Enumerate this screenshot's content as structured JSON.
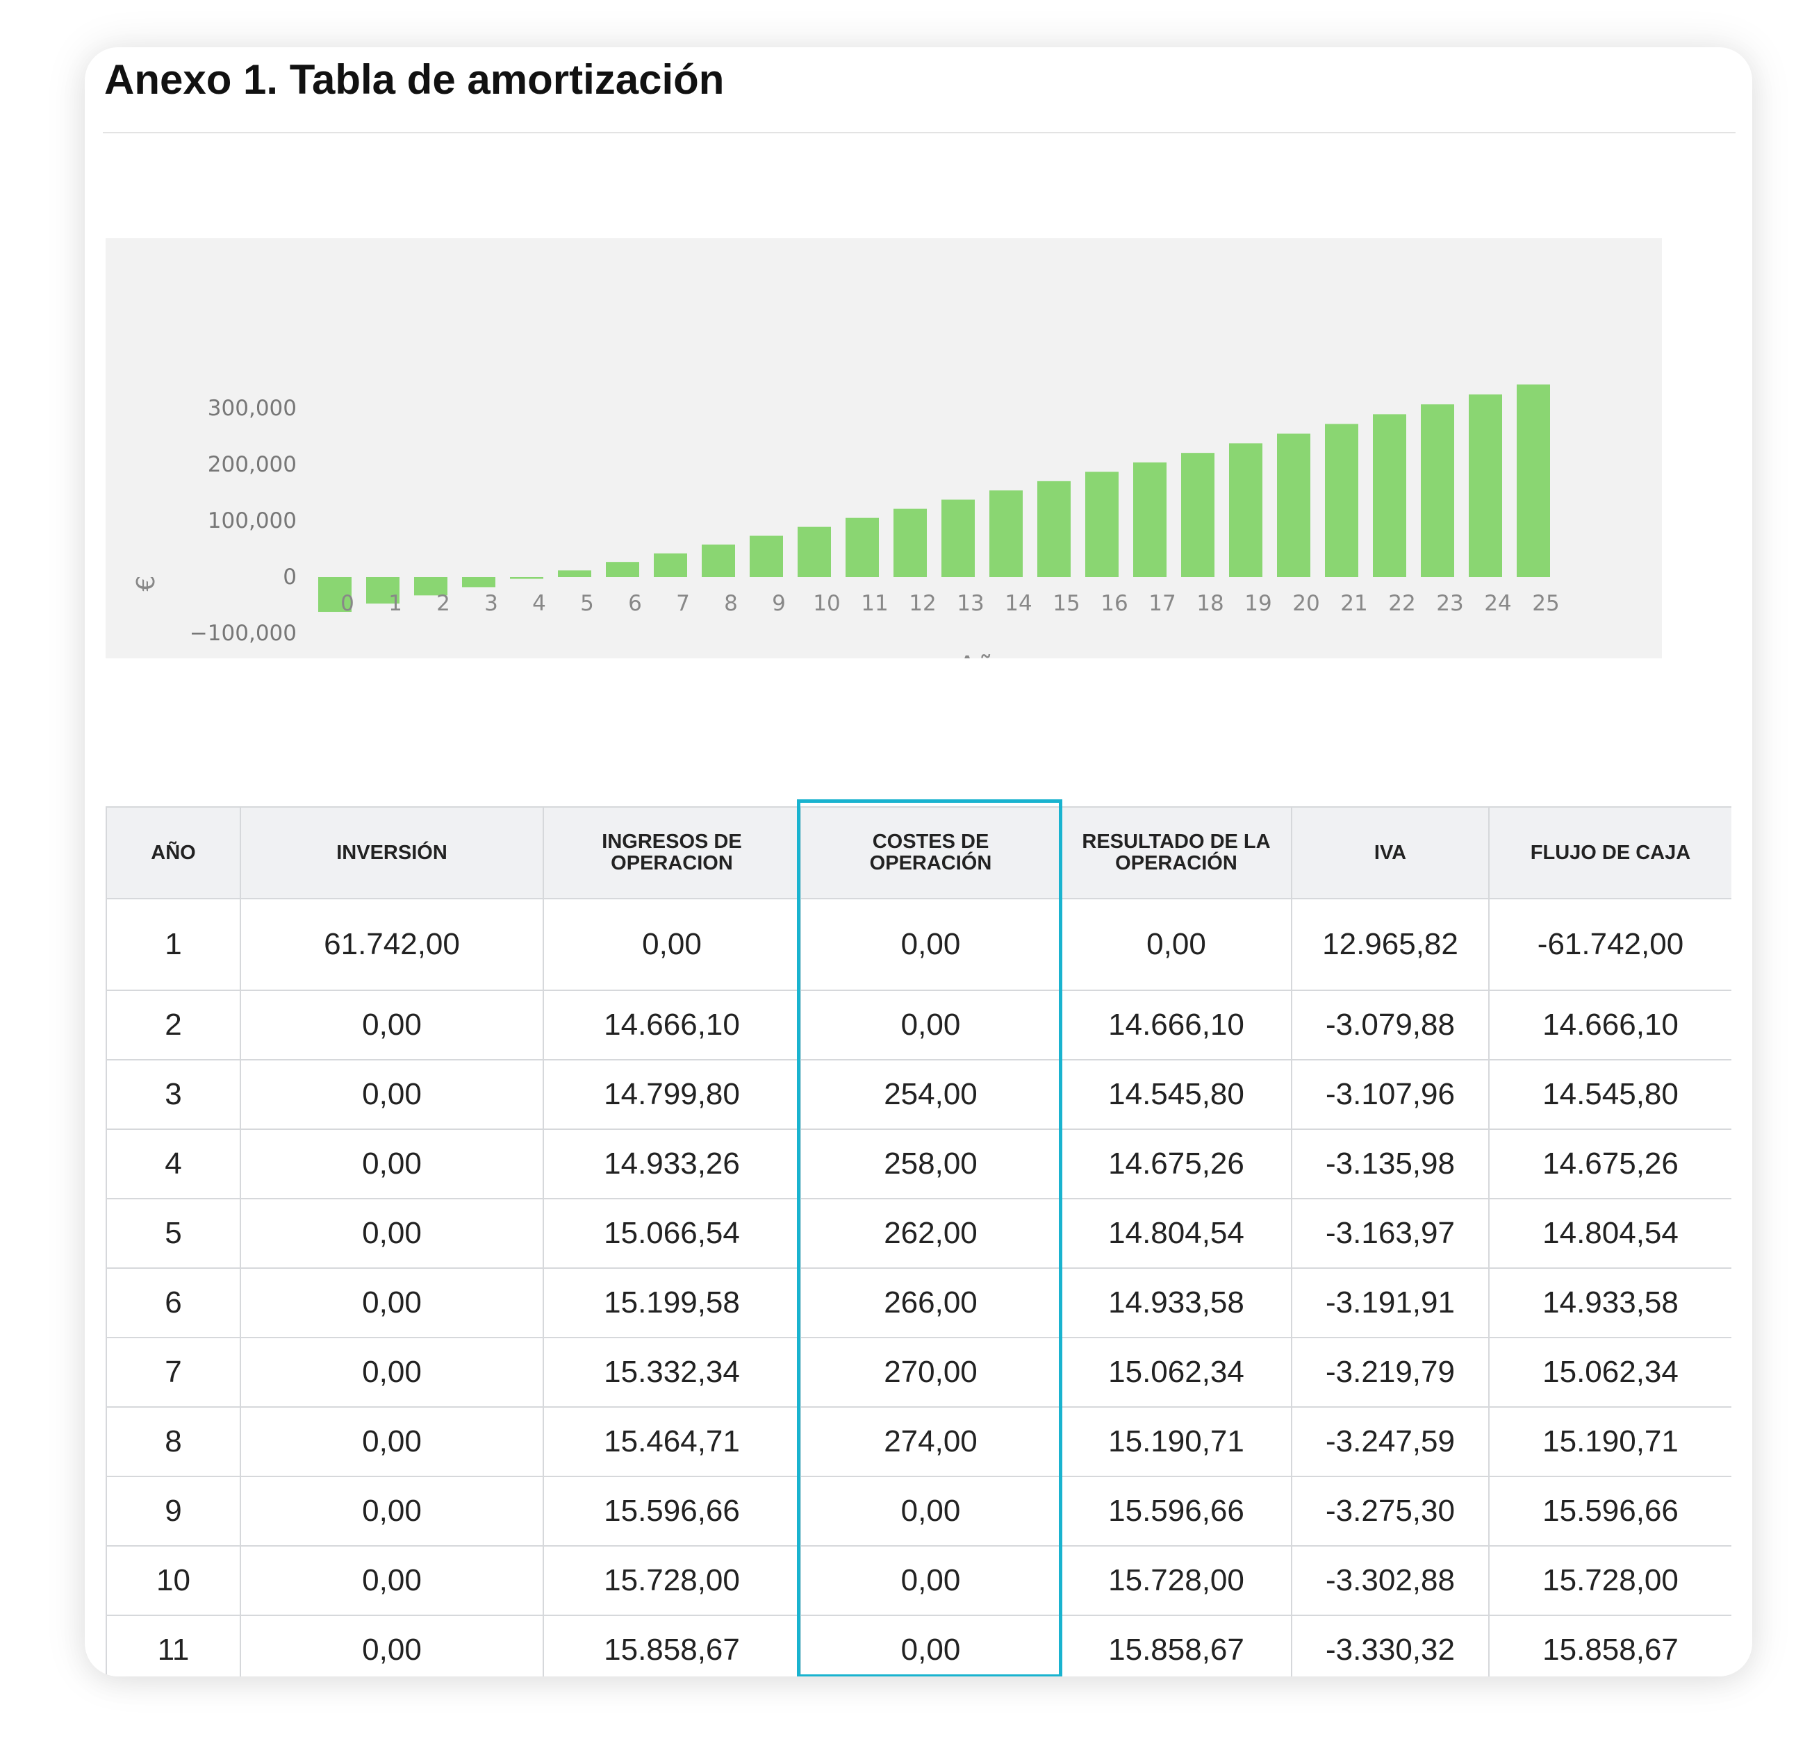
{
  "title": "Anexo 1. Tabla de amortización",
  "chart_data": {
    "type": "bar",
    "xlabel": "Año",
    "ylabel": "€",
    "ylim": [
      -100000,
      350000
    ],
    "yticks": [
      -100000,
      0,
      100000,
      200000,
      300000
    ],
    "ytick_labels": [
      "−100,000",
      "0",
      "100,000",
      "200,000",
      "300,000"
    ],
    "categories": [
      "0",
      "1",
      "2",
      "3",
      "4",
      "5",
      "6",
      "7",
      "8",
      "9",
      "10",
      "11",
      "12",
      "13",
      "14",
      "15",
      "16",
      "17",
      "18",
      "19",
      "20",
      "21",
      "22",
      "23",
      "24",
      "25"
    ],
    "values": [
      -61742,
      -47076,
      -32530,
      -17855,
      -3050,
      11883,
      26946,
      42136,
      57732,
      73460,
      89319,
      105308,
      121426,
      137672,
      154046,
      170548,
      187176,
      203931,
      220813,
      237820,
      254953,
      272212,
      289596,
      307104,
      324737,
      342494
    ],
    "bar_color": "#8ad672",
    "background": "#f2f2f2",
    "grid": false
  },
  "table": {
    "headers": [
      [
        "AÑO"
      ],
      [
        "INVERSIÓN"
      ],
      [
        "INGRESOS DE",
        "OPERACION"
      ],
      [
        "COSTES DE",
        "OPERACIÓN"
      ],
      [
        "RESULTADO DE LA",
        "OPERACIÓN"
      ],
      [
        "IVA"
      ],
      [
        "FLUJO DE CAJA"
      ]
    ],
    "rows": [
      [
        "1",
        "61.742,00",
        "0,00",
        "0,00",
        "0,00",
        "12.965,82",
        "-61.742,00"
      ],
      [
        "2",
        "0,00",
        "14.666,10",
        "0,00",
        "14.666,10",
        "-3.079,88",
        "14.666,10"
      ],
      [
        "3",
        "0,00",
        "14.799,80",
        "254,00",
        "14.545,80",
        "-3.107,96",
        "14.545,80"
      ],
      [
        "4",
        "0,00",
        "14.933,26",
        "258,00",
        "14.675,26",
        "-3.135,98",
        "14.675,26"
      ],
      [
        "5",
        "0,00",
        "15.066,54",
        "262,00",
        "14.804,54",
        "-3.163,97",
        "14.804,54"
      ],
      [
        "6",
        "0,00",
        "15.199,58",
        "266,00",
        "14.933,58",
        "-3.191,91",
        "14.933,58"
      ],
      [
        "7",
        "0,00",
        "15.332,34",
        "270,00",
        "15.062,34",
        "-3.219,79",
        "15.062,34"
      ],
      [
        "8",
        "0,00",
        "15.464,71",
        "274,00",
        "15.190,71",
        "-3.247,59",
        "15.190,71"
      ],
      [
        "9",
        "0,00",
        "15.596,66",
        "0,00",
        "15.596,66",
        "-3.275,30",
        "15.596,66"
      ],
      [
        "10",
        "0,00",
        "15.728,00",
        "0,00",
        "15.728,00",
        "-3.302,88",
        "15.728,00"
      ],
      [
        "11",
        "0,00",
        "15.858,67",
        "0,00",
        "15.858,67",
        "-3.330,32",
        "15.858,67"
      ]
    ]
  },
  "highlight_color": "#19b3cf"
}
